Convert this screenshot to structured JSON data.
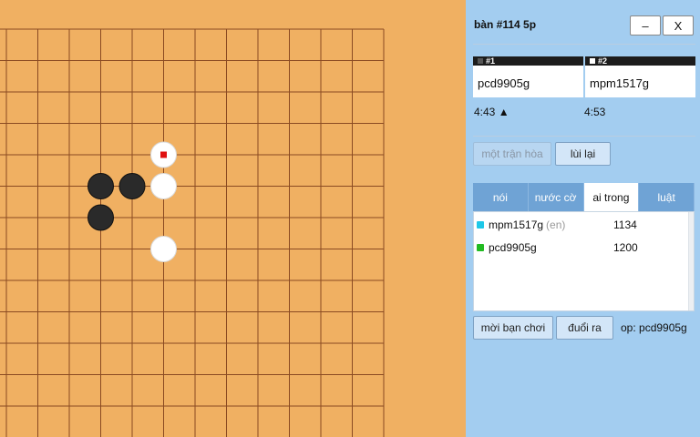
{
  "board": {
    "grid_color": "#8a4a22",
    "background": "#f0b062",
    "black_stones": [
      [
        3,
        5
      ],
      [
        4,
        5
      ],
      [
        3,
        6
      ]
    ],
    "white_stones": [
      [
        5,
        4
      ],
      [
        5,
        5
      ],
      [
        5,
        7
      ]
    ],
    "last_move": [
      5,
      4
    ],
    "last_move_marker_color": "#e01010"
  },
  "header": {
    "title": "bàn #114   5p",
    "minimize_label": "–",
    "close_label": "X"
  },
  "players": [
    {
      "slot": "#1",
      "name": "pcd9905g",
      "time": "4:43 ▲",
      "marker_color": "#555555"
    },
    {
      "slot": "#2",
      "name": "mpm1517g",
      "time": "4:53",
      "marker_color": "#ffffff"
    }
  ],
  "actions": {
    "draw_label": "một trận hòa",
    "undo_label": "lùi lại",
    "invite_label": "mời bạn chơi",
    "kick_label": "đuổi ra",
    "op_text": "op: pcd9905g"
  },
  "tabs": [
    {
      "label": "nói",
      "active": false
    },
    {
      "label": "nước cờ",
      "active": false
    },
    {
      "label": "ai trong",
      "active": true
    },
    {
      "label": "luật",
      "active": false
    }
  ],
  "users": [
    {
      "name": "mpm1517g",
      "tag": "(en)",
      "score": "1134",
      "color": "#1ec8e8"
    },
    {
      "name": "pcd9905g",
      "tag": "",
      "score": "1200",
      "color": "#22bb22"
    }
  ]
}
